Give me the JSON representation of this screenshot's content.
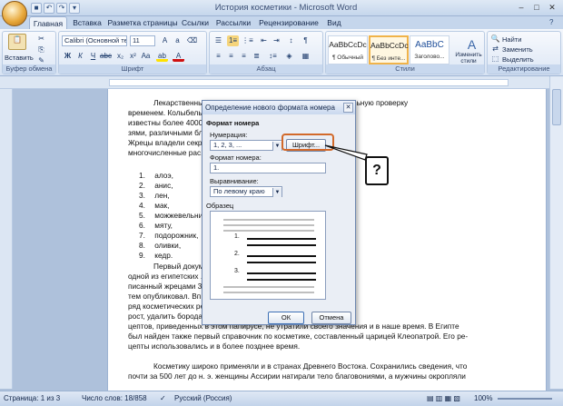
{
  "window": {
    "title": "История косметики - Microsoft Word"
  },
  "tabs": [
    "Главная",
    "Вставка",
    "Разметка страницы",
    "Ссылки",
    "Рассылки",
    "Рецензирование",
    "Вид"
  ],
  "ribbon": {
    "clipboard": {
      "label": "Буфер обмена",
      "paste": "Вставить"
    },
    "font": {
      "label": "Шрифт",
      "name": "Calibri (Основной те",
      "size": "11"
    },
    "paragraph": {
      "label": "Абзац"
    },
    "styles": {
      "label": "Стили",
      "items": [
        {
          "preview": "AaBbCcDc",
          "name": "¶ Обычный"
        },
        {
          "preview": "AaBbCcDc",
          "name": "¶ Без инте..."
        },
        {
          "preview": "AaBbC",
          "name": "Заголово..."
        }
      ],
      "change": "Изменить стили"
    },
    "editing": {
      "label": "Редактирование",
      "find": "Найти",
      "replace": "Заменить",
      "select": "Выделить"
    }
  },
  "document": {
    "lines": [
      "Лекарственные растения использовались прошли длительную проверку",
      "временем. Колыбелью ... косметические средства были",
      "известны более 4000 ... лений обнаружены сосуды с ма-",
      "зями, различными бла... овое и лавандовое масло.",
      "Жрецы владели секр... х средств. Они использовали",
      "многочисленные рас..."
    ],
    "list": [
      "алоэ,",
      "анис,",
      "лен,",
      "мак,",
      "можжевельник,",
      "мяту,",
      "подорожник,",
      "оливки,",
      "кедр."
    ],
    "lines2": [
      "Первый докум... метических правил, найден в",
      "одной из египетских ... длиной примерно в 21 метр, на-",
      "писанный жрецами 3... са в 1875 г. приобрел его и за-",
      "тем опубликовал. Вп... Папирус Берса». Он содержал",
      "ряд косметических ре... покрасить волосы, усилить их",
      "рост, удалить бородав... растения. Некоторые из ре-",
      "цептов, приведенных в этом папирусе, не утратили своего значения и в наше время. В Египте",
      "был найден также первый справочник по косметике, составленный царицей Клеопатрой. Его ре-",
      "цепты использовались и в более позднее время.",
      "",
      "Косметику широко применяли и в странах Древнего Востока. Сохранились сведения, что",
      "почти за 500 лет до н. э. женщины Ассирии натирали тело благовониями, а мужчины окропляли"
    ]
  },
  "dialog": {
    "title": "Определение нового формата номера",
    "section": "Формат номера",
    "numbering_label": "Нумерация:",
    "numbering_value": "1, 2, 3, ...",
    "font_button": "Шрифт...",
    "format_label": "Формат номера:",
    "format_value": "1.",
    "align_label": "Выравнивание:",
    "align_value": "По левому краю",
    "sample_label": "Образец",
    "preview_numbers": [
      "1.",
      "2.",
      "3."
    ],
    "ok": "ОК",
    "cancel": "Отмена"
  },
  "callout": {
    "text": "?"
  },
  "status": {
    "page": "Страница: 1 из 3",
    "words": "Число слов: 18/858",
    "lang": "Русский (Россия)",
    "zoom": "100%"
  }
}
